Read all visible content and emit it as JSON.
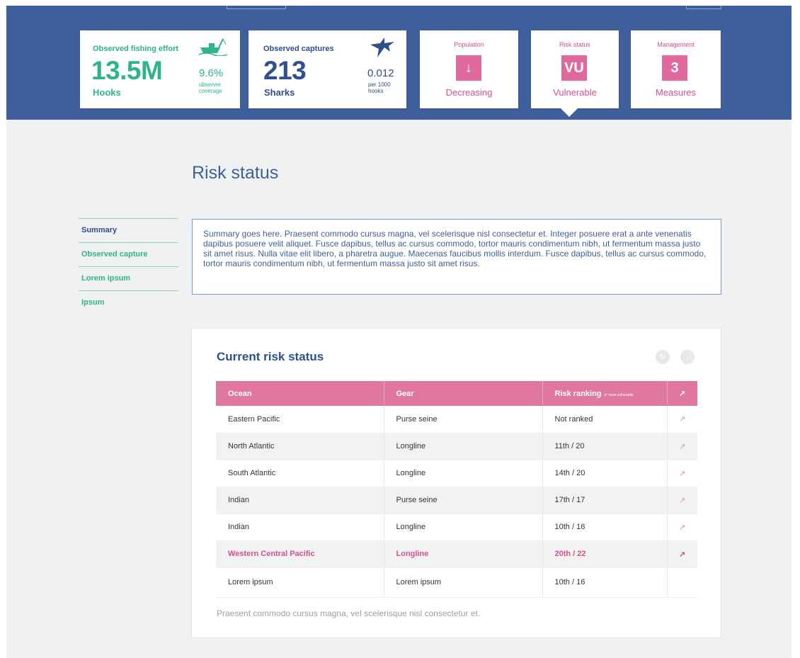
{
  "cards": {
    "effort": {
      "title": "Observed fishing effort",
      "value": "13.5M",
      "unit": "Hooks",
      "ratio": "9.6%",
      "note_line1": "observer",
      "note_line2": "coverage",
      "icon": "fishing-boat-icon"
    },
    "captures": {
      "title": "Observed captures",
      "value": "213",
      "unit": "Sharks",
      "ratio": "0.012",
      "note_line1": "per 1000",
      "note_line2": "hooks",
      "icon": "shark-icon"
    },
    "population": {
      "title": "Population",
      "badge": "↓",
      "label": "Decreasing"
    },
    "risk": {
      "title": "Risk status",
      "badge": "VU",
      "label": "Vulnerable"
    },
    "management": {
      "title": "Management",
      "badge": "3",
      "label": "Measures"
    }
  },
  "page": {
    "title": "Risk status"
  },
  "sidenav": [
    {
      "label": "Summary"
    },
    {
      "label": "Observed capture"
    },
    {
      "label": "Lorem ipsum"
    },
    {
      "label": "Ipsum"
    }
  ],
  "summary": {
    "text": "Summary goes here. Praesent commodo cursus magna, vel scelerisque nisl consectetur et. Integer posuere erat a ante venenatis dapibus posuere velit aliquet. Fusce dapibus, tellus ac cursus commodo, tortor mauris condimentum nibh, ut fermentum massa justo sit amet risus. Nulla vitae elit libero, a pharetra augue. Maecenas faucibus mollis interdum. Fusce dapibus, tellus ac cursus commodo, tortor mauris condimentum nibh, ut fermentum massa justo sit amet risus."
  },
  "panel": {
    "title": "Current risk status",
    "table": {
      "headers": {
        "ocean": "Ocean",
        "gear": "Gear",
        "ranking": "Risk ranking",
        "ranking_note": "nº most vulnerable"
      },
      "rows": [
        {
          "ocean": "Eastern Pacific",
          "gear": "Purse seine",
          "ranking": "Not ranked"
        },
        {
          "ocean": "North Atlantic",
          "gear": "Longline",
          "ranking": "11th / 20"
        },
        {
          "ocean": "South Atlantic",
          "gear": "Longline",
          "ranking": "14th / 20"
        },
        {
          "ocean": "Indian",
          "gear": "Purse seine",
          "ranking": "17th / 17"
        },
        {
          "ocean": "Indian",
          "gear": "Longline",
          "ranking": "10th / 16"
        },
        {
          "ocean": "Western Central Pacific",
          "gear": "Longline",
          "ranking": "20th / 22"
        },
        {
          "ocean": "Lorem ipsum",
          "gear": "Lorem ipsum",
          "ranking": "10th / 16"
        }
      ]
    },
    "footnote": "Praesent commodo cursus magna, vel scelerisque nisl consectetur et."
  },
  "colors": {
    "banner": "#3f5f9c",
    "green": "#2fb38a",
    "pink": "#d94f8e",
    "table_header": "#df77a0"
  }
}
